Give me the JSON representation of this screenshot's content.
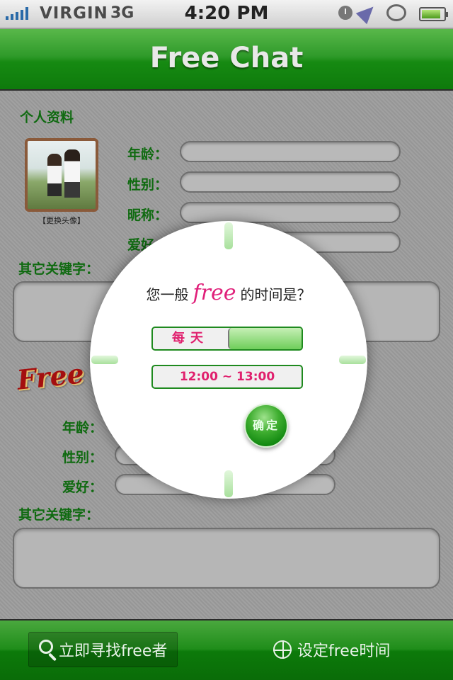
{
  "status_bar": {
    "carrier": "VIRGIN",
    "network": "3G",
    "time": "4:20 PM"
  },
  "header": {
    "title": "Free Chat"
  },
  "profile": {
    "section_title": "个人资料",
    "avatar_caption": "【更换头像】",
    "age_label": "年龄：",
    "gender_label": "性别：",
    "nickname_label": "昵称：",
    "hobby_label": "爱好",
    "other_keywords_label": "其它关键字："
  },
  "free_section": {
    "logo": "Free",
    "age_label": "年龄：",
    "gender_label": "性别：",
    "hobby_label": "爱好：",
    "other_keywords_label": "其它关键字："
  },
  "dialog": {
    "question_before": "您一般",
    "question_free": "free",
    "question_after": "的时间是？",
    "frequency": "每天",
    "time_range": "12:00 ~ 13:00",
    "confirm_label": "确定"
  },
  "tab_bar": {
    "find_label": "立即寻找free者",
    "set_time_label": "设定free时间"
  }
}
